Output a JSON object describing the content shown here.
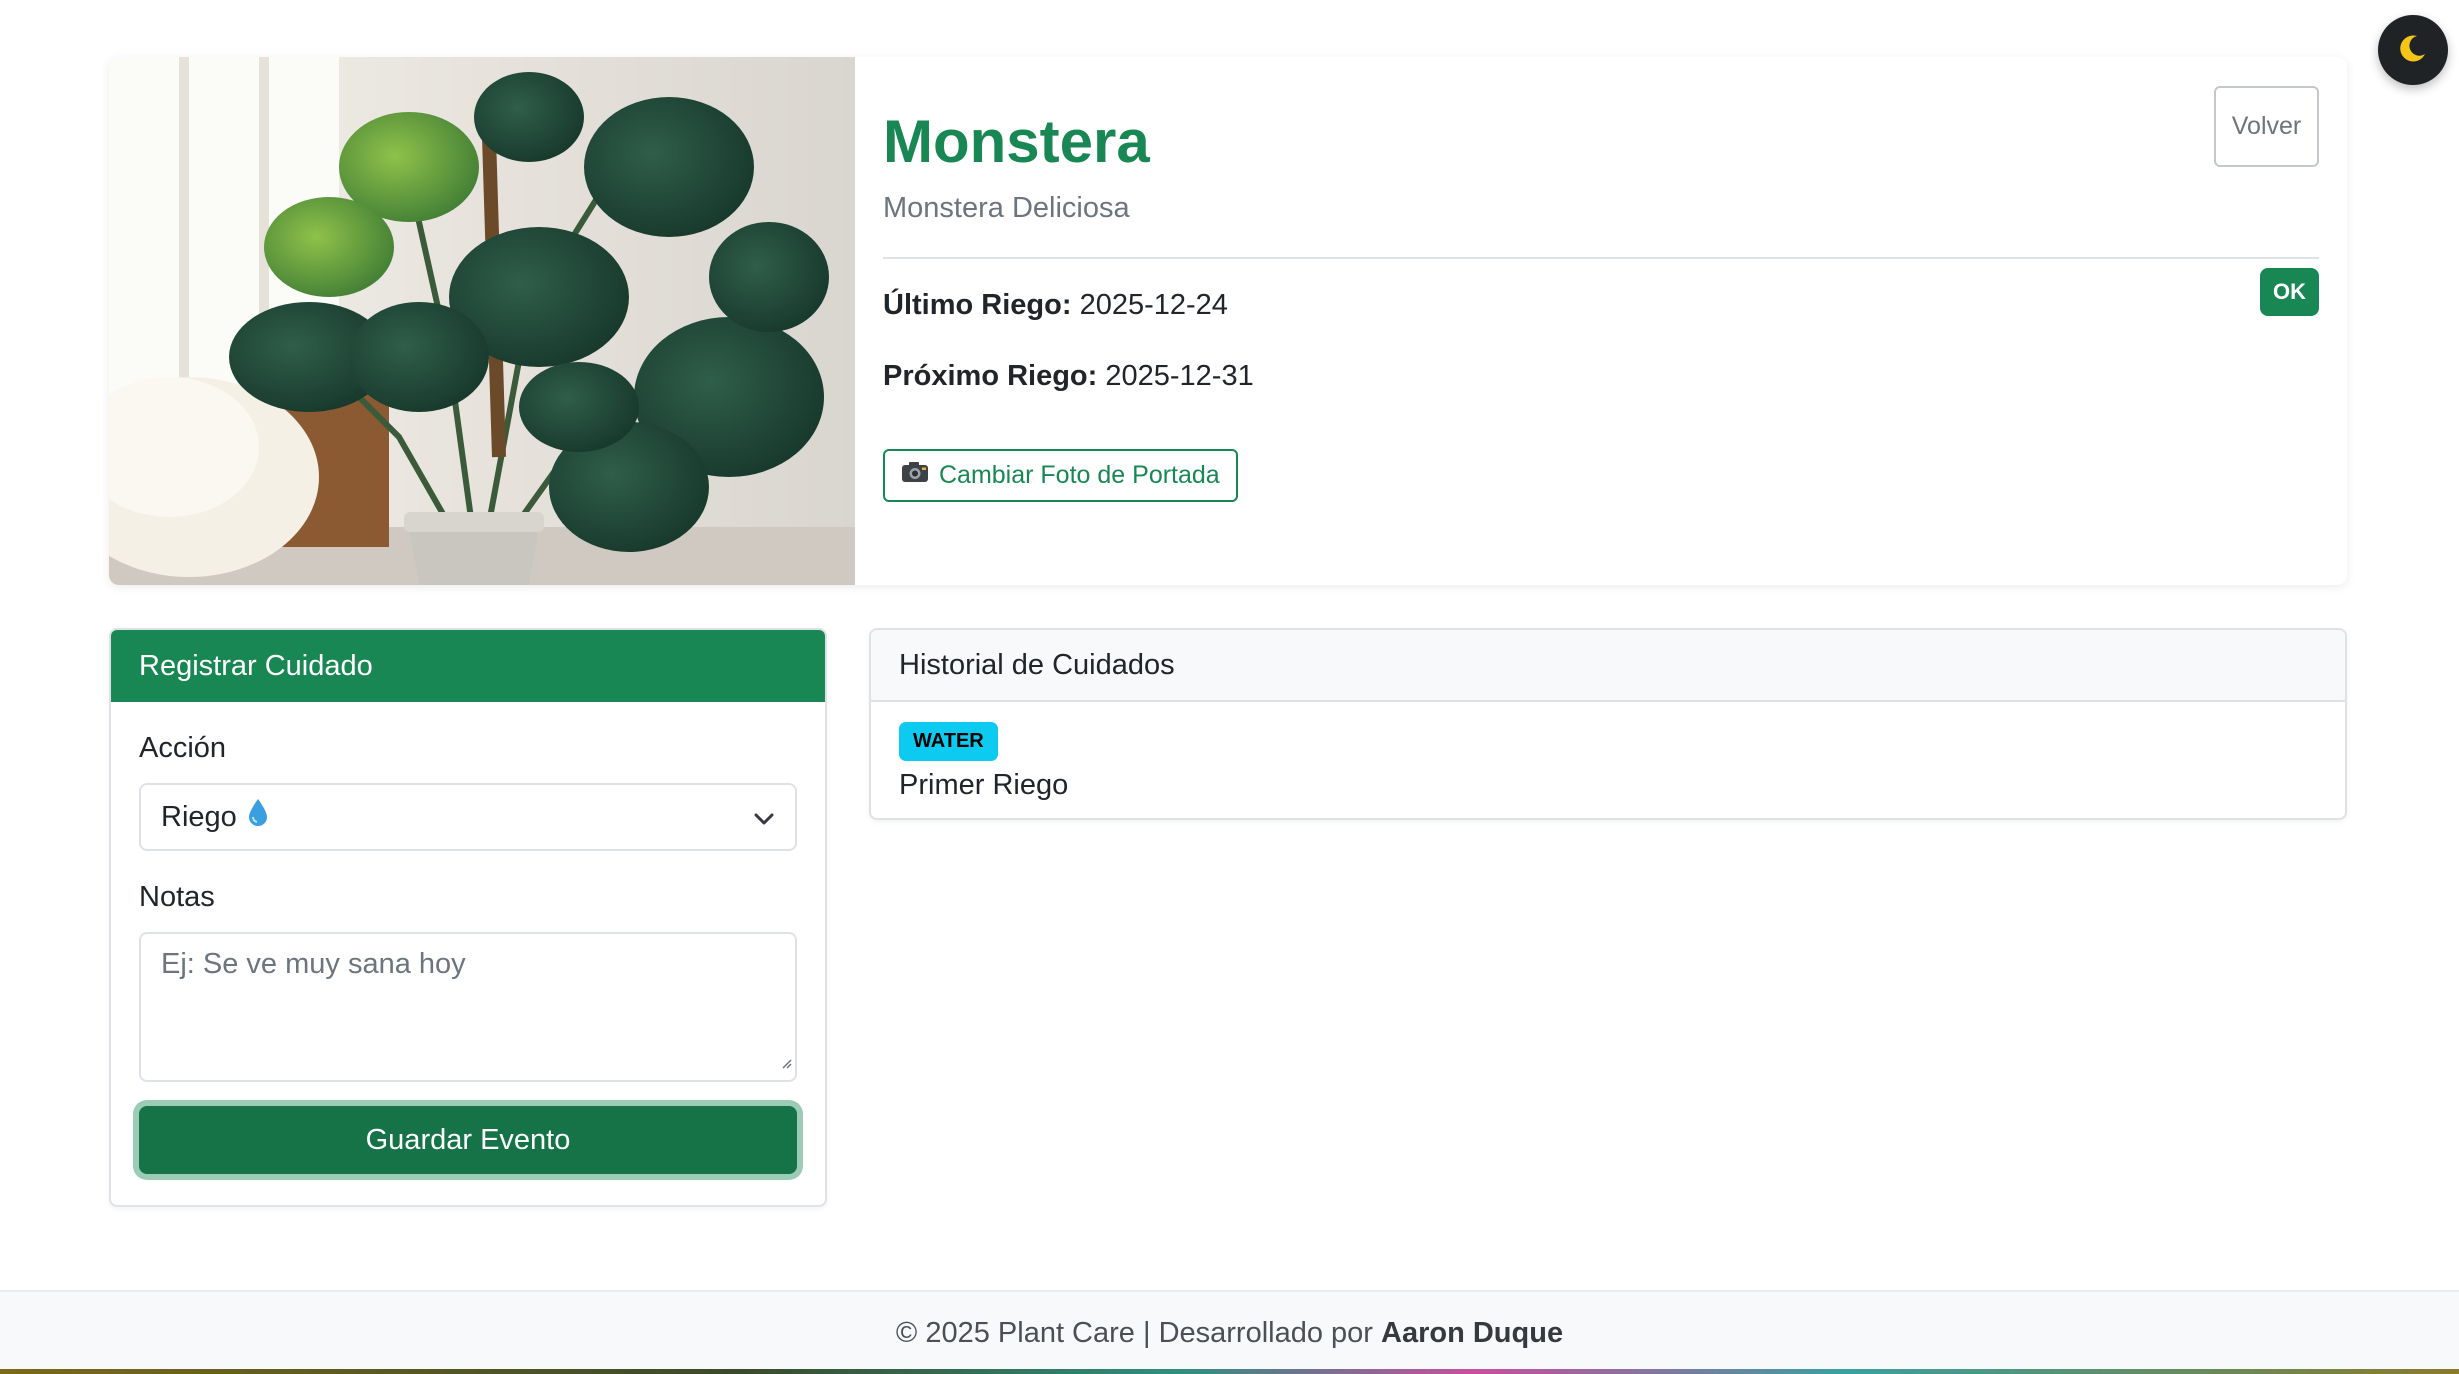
{
  "plant": {
    "name": "Monstera",
    "scientific_name": "Monstera Deliciosa",
    "last_watering_label": "Último Riego:",
    "last_watering_value": "2025-12-24",
    "next_watering_label": "Próximo Riego:",
    "next_watering_value": "2025-12-31",
    "status_badge": "OK",
    "back_button": "Volver",
    "change_cover_button": "Cambiar Foto de Portada",
    "change_cover_icon": "camera-icon"
  },
  "register_care": {
    "title": "Registrar Cuidado",
    "action_label": "Acción",
    "action_value": "Riego",
    "action_icon": "water-drop-icon",
    "notes_label": "Notas",
    "notes_placeholder": "Ej: Se ve muy sana hoy",
    "save_button": "Guardar Evento"
  },
  "history": {
    "title": "Historial de Cuidados",
    "items": [
      {
        "type": "WATER",
        "note": "Primer Riego"
      }
    ]
  },
  "footer": {
    "prefix": "© 2025 Plant Care | Desarrollado por",
    "author": "Aaron Duque"
  },
  "theme_toggle_icon": "moon-icon",
  "colors": {
    "primary": "#198754",
    "info": "#0dcaf0",
    "muted": "#6c757d"
  }
}
